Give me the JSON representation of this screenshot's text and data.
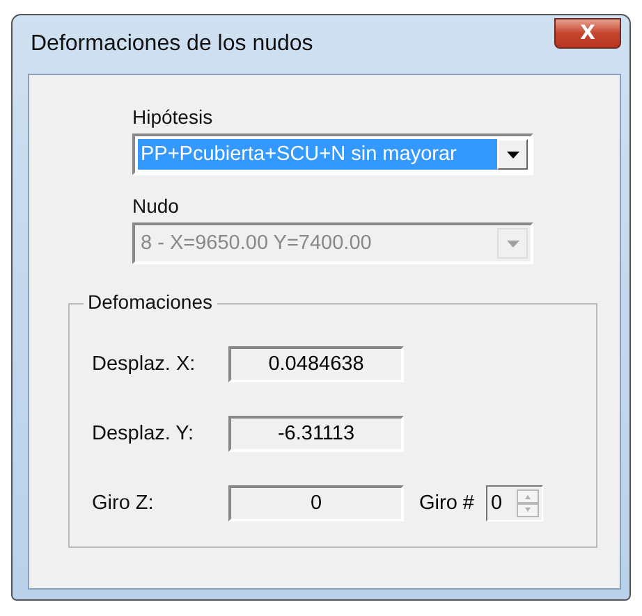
{
  "window": {
    "title": "Deformaciones de los nudos",
    "close_button": "X"
  },
  "hipotesis": {
    "label": "Hipótesis",
    "value": "PP+Pcubierta+SCU+N sin mayorar",
    "disabled": false,
    "selected": true
  },
  "nudo": {
    "label": "Nudo",
    "value": "8 - X=9650.00 Y=7400.00",
    "disabled": true,
    "selected": false
  },
  "group": {
    "title": "Defomaciones",
    "rows": [
      {
        "label": "Desplaz. X:",
        "value": "0.0484638"
      },
      {
        "label": "Desplaz. Y:",
        "value": "-6.31113"
      },
      {
        "label": "Giro Z:",
        "value": "0"
      }
    ],
    "giro": {
      "label": "Giro #",
      "value": "0"
    }
  }
}
